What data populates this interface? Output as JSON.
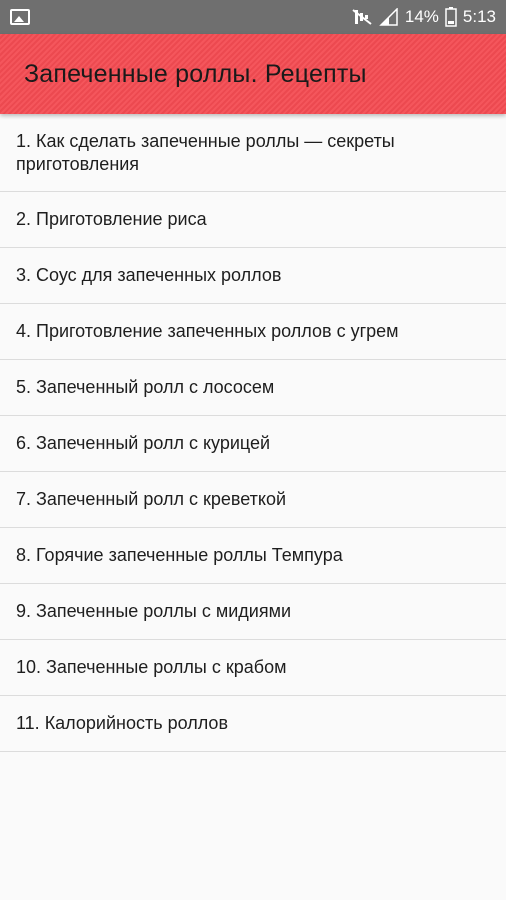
{
  "status_bar": {
    "battery": "14%",
    "time": "5:13",
    "icons": [
      "image-notification-icon",
      "mute-icon",
      "signal-icon",
      "battery-icon"
    ]
  },
  "app_bar": {
    "title": "Запеченные роллы. Рецепты",
    "color": "#f44b52"
  },
  "recipes": [
    "1. Как сделать запеченные роллы — секреты приготовления",
    "2. Приготовление риса",
    "3. Соус для запеченных роллов",
    "4. Приготовление запеченных роллов с угрем",
    "5. Запеченный ролл с лососем",
    "6. Запеченный ролл с курицей",
    "7. Запеченный ролл с креветкой",
    "8. Горячие запеченные роллы Темпура",
    "9. Запеченные роллы с мидиями",
    "10. Запеченные роллы с крабом",
    "11. Калорийность роллов"
  ]
}
